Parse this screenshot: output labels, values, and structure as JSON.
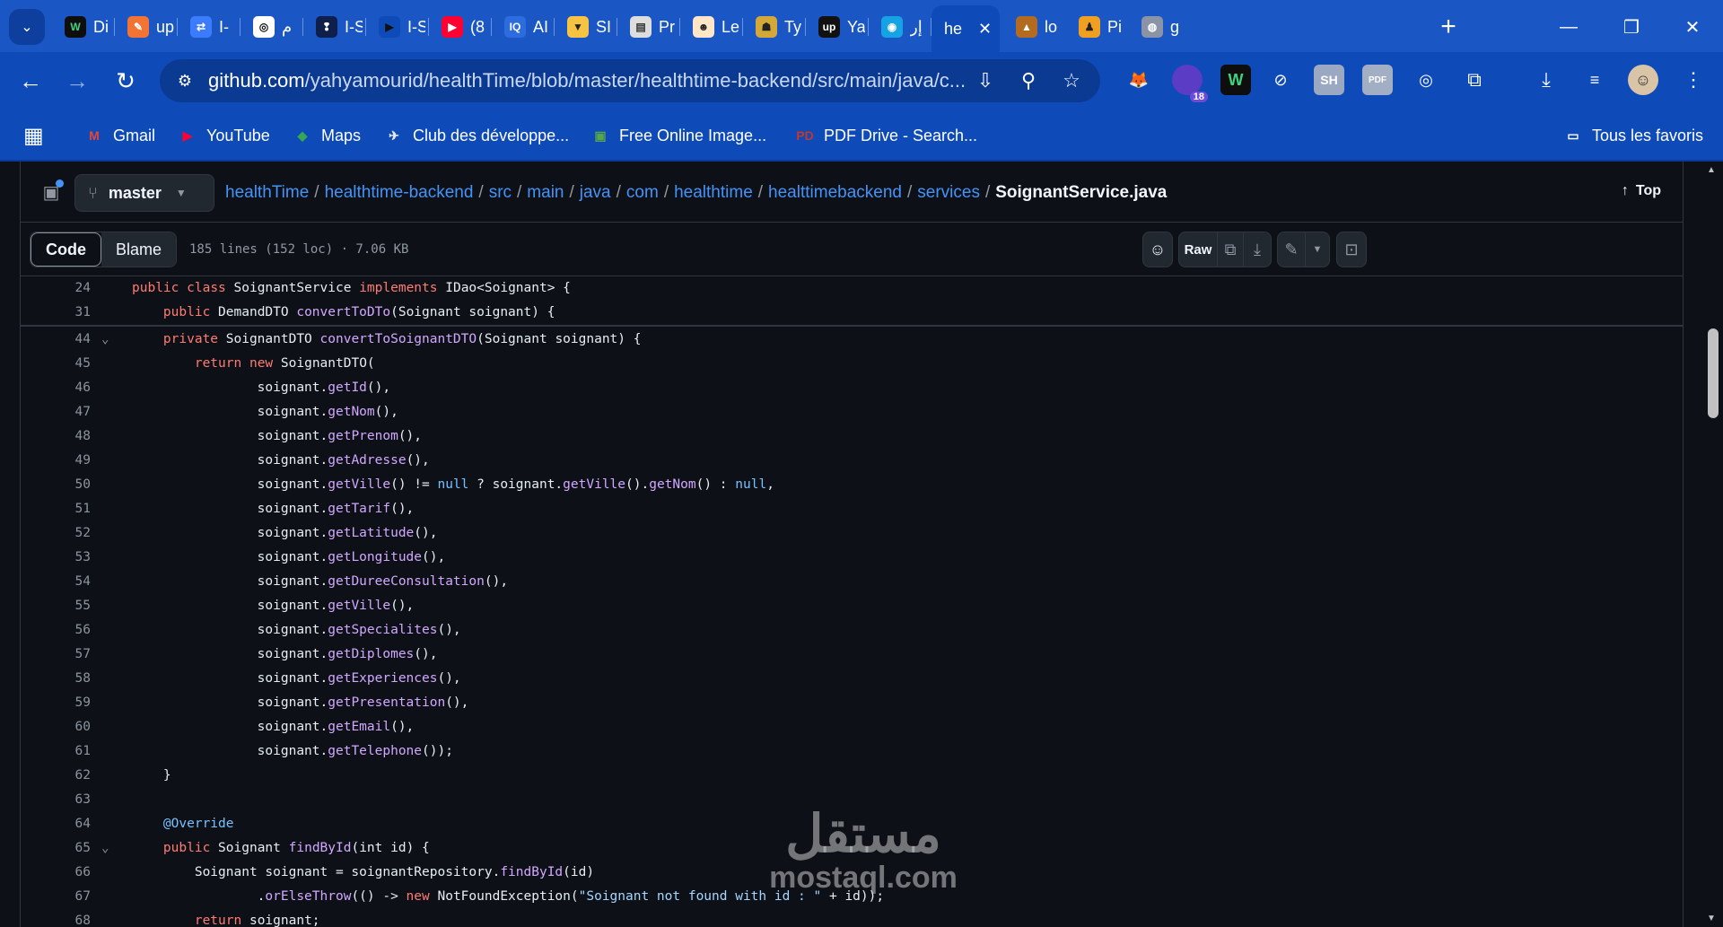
{
  "tabs": [
    {
      "fav": "W",
      "title": "Di",
      "favbg": "#0e0e0e",
      "favfg": "#3fd27f"
    },
    {
      "fav": "✎",
      "title": "up",
      "favbg": "#f37335",
      "favfg": "#ffffff"
    },
    {
      "fav": "⇄",
      "title": "I-",
      "favbg": "#3b7cff",
      "favfg": "#ffffff"
    },
    {
      "fav": "◎",
      "title": "م",
      "favbg": "#ffffff",
      "favfg": "#111111"
    },
    {
      "fav": "❢",
      "title": "I-S",
      "favbg": "#0d1f4a",
      "favfg": "#ffffff"
    },
    {
      "fav": "▶",
      "title": "I-S",
      "favbg": "#0f4bb8",
      "favfg": "#111111"
    },
    {
      "fav": "▶",
      "title": "(8",
      "favbg": "#ff0033",
      "favfg": "#ffffff"
    },
    {
      "fav": "IQ",
      "title": "AI",
      "favbg": "#2d6cdf",
      "favfg": "#ffffff"
    },
    {
      "fav": "▼",
      "title": "SI",
      "favbg": "#f6c343",
      "favfg": "#222222"
    },
    {
      "fav": "▤",
      "title": "Pr",
      "favbg": "#dddddd",
      "favfg": "#333333"
    },
    {
      "fav": "☻",
      "title": "Le",
      "favbg": "#ffe6c9",
      "favfg": "#222222"
    },
    {
      "fav": "☗",
      "title": "Ty",
      "favbg": "#d4a838",
      "favfg": "#222222"
    },
    {
      "fav": "up",
      "title": "Ya",
      "favbg": "#111111",
      "favfg": "#ffffff"
    },
    {
      "fav": "◉",
      "title": "إر",
      "favbg": "#16a3e6",
      "favfg": "#ffffff"
    }
  ],
  "active_tab": {
    "title": "he",
    "close": "✕"
  },
  "tabs_after": [
    {
      "fav": "▲",
      "title": "lo",
      "favbg": "#b36b1f",
      "favfg": "#ffffff"
    },
    {
      "fav": "♟",
      "title": "Pi",
      "favbg": "#f0a020",
      "favfg": "#222222"
    },
    {
      "fav": "◍",
      "title": "g",
      "favbg": "#8a94a6",
      "favfg": "#ffffff"
    }
  ],
  "window": {
    "new_tab": "+",
    "minimize": "—",
    "restore": "❐",
    "close": "✕"
  },
  "toolbar": {
    "back": "←",
    "forward": "→",
    "reload": "↻",
    "url_host": "github.com",
    "url_path": "/yahyamourid/healthTime/blob/master/healthtime-backend/src/main/java/c...",
    "badge": "18"
  },
  "bookmarks": [
    {
      "label": "Gmail",
      "icon": "M",
      "color": "#ea4335"
    },
    {
      "label": "YouTube",
      "icon": "▶",
      "color": "#ff0033"
    },
    {
      "label": "Maps",
      "icon": "◆",
      "color": "#34a853"
    },
    {
      "label": "Club des développe...",
      "icon": "✈",
      "color": "#e8e8e8"
    },
    {
      "label": "Free Online Image...",
      "icon": "▣",
      "color": "#57a64a"
    },
    {
      "label": "PDF Drive - Search...",
      "icon": "PD",
      "color": "#c0392b"
    }
  ],
  "all_bookmarks": "Tous les favoris",
  "repo": {
    "branch": "master",
    "breadcrumb": [
      "healthTime",
      "healthtime-backend",
      "src",
      "main",
      "java",
      "com",
      "healthtime",
      "healttimebackend",
      "services"
    ],
    "file": "SoignantService.java",
    "top": "Top",
    "tab_code": "Code",
    "tab_blame": "Blame",
    "meta": "185 lines (152 loc) · 7.06 KB",
    "raw": "Raw"
  },
  "sticky_lines": [
    {
      "n": "24",
      "html": "<span class=\"k\">public</span> <span class=\"k\">class</span> SoignantService <span class=\"k\">implements</span> IDao&lt;Soignant&gt; {"
    },
    {
      "n": "31",
      "html": "    <span class=\"k\">public</span> DemandDTO <span class=\"f\">convertToDTo</span>(Soignant soignant) {"
    }
  ],
  "code_lines": [
    {
      "n": "44",
      "fold": true,
      "html": "    <span class=\"k\">private</span> SoignantDTO <span class=\"f\">convertToSoignantDTO</span>(Soignant soignant) {"
    },
    {
      "n": "45",
      "html": "        <span class=\"k\">return</span> <span class=\"k\">new</span> SoignantDTO("
    },
    {
      "n": "46",
      "html": "                soignant.<span class=\"f\">getId</span>(),"
    },
    {
      "n": "47",
      "html": "                soignant.<span class=\"f\">getNom</span>(),"
    },
    {
      "n": "48",
      "html": "                soignant.<span class=\"f\">getPrenom</span>(),"
    },
    {
      "n": "49",
      "html": "                soignant.<span class=\"f\">getAdresse</span>(),"
    },
    {
      "n": "50",
      "html": "                soignant.<span class=\"f\">getVille</span>() != <span class=\"c\">null</span> ? soignant.<span class=\"f\">getVille</span>().<span class=\"f\">getNom</span>() : <span class=\"c\">null</span>,"
    },
    {
      "n": "51",
      "html": "                soignant.<span class=\"f\">getTarif</span>(),"
    },
    {
      "n": "52",
      "html": "                soignant.<span class=\"f\">getLatitude</span>(),"
    },
    {
      "n": "53",
      "html": "                soignant.<span class=\"f\">getLongitude</span>(),"
    },
    {
      "n": "54",
      "html": "                soignant.<span class=\"f\">getDureeConsultation</span>(),"
    },
    {
      "n": "55",
      "html": "                soignant.<span class=\"f\">getVille</span>(),"
    },
    {
      "n": "56",
      "html": "                soignant.<span class=\"f\">getSpecialites</span>(),"
    },
    {
      "n": "57",
      "html": "                soignant.<span class=\"f\">getDiplomes</span>(),"
    },
    {
      "n": "58",
      "html": "                soignant.<span class=\"f\">getExperiences</span>(),"
    },
    {
      "n": "59",
      "html": "                soignant.<span class=\"f\">getPresentation</span>(),"
    },
    {
      "n": "60",
      "html": "                soignant.<span class=\"f\">getEmail</span>(),"
    },
    {
      "n": "61",
      "html": "                soignant.<span class=\"f\">getTelephone</span>());"
    },
    {
      "n": "62",
      "html": "    }"
    },
    {
      "n": "63",
      "html": ""
    },
    {
      "n": "64",
      "html": "    <span class=\"c\">@Override</span>"
    },
    {
      "n": "65",
      "fold": true,
      "html": "    <span class=\"k\">public</span> Soignant <span class=\"f\">findById</span>(int id) {"
    },
    {
      "n": "66",
      "html": "        Soignant soignant = soignantRepository.<span class=\"f\">findById</span>(id)"
    },
    {
      "n": "67",
      "html": "                .<span class=\"f\">orElseThrow</span>(() -&gt; <span class=\"k\">new</span> NotFoundException(<span class=\"s\">\"Soignant not found with id : \"</span> + id));"
    },
    {
      "n": "68",
      "html": "        <span class=\"k\">return</span> soignant;"
    }
  ],
  "watermark": {
    "arabic": "مستقل",
    "latin": "mostaql.com"
  }
}
